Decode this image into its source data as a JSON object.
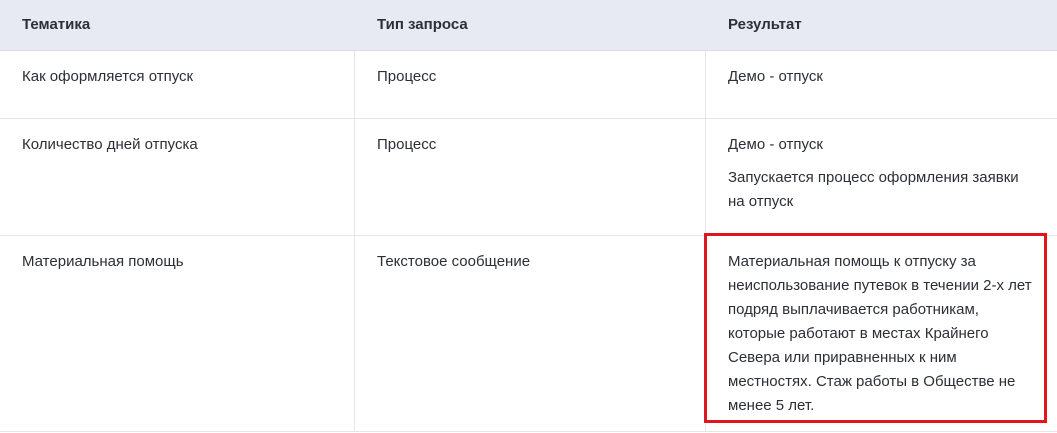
{
  "table": {
    "headers": [
      "Тематика",
      "Тип запроса",
      "Результат"
    ],
    "rows": [
      {
        "topic": "Как оформляется отпуск",
        "request_type": "Процесс",
        "result": [
          "Демо - отпуск"
        ]
      },
      {
        "topic": "Количество дней отпуска",
        "request_type": "Процесс",
        "result": [
          "Демо - отпуск",
          "Запускается процесс оформления заявки на отпуск"
        ]
      },
      {
        "topic": "Материальная помощь",
        "request_type": "Текстовое сообщение",
        "result": [
          "Материальная помощь к отпуску за неиспользование путевок в течении 2-х лет подряд выплачивается работникам, которые работают в местах Крайнего Севера или приравненных к ним местностях. Стаж работы в Обществе не менее 5 лет."
        ]
      }
    ]
  },
  "colors": {
    "header_bg": "#e7eaf2",
    "highlight_border": "#e0161e"
  }
}
